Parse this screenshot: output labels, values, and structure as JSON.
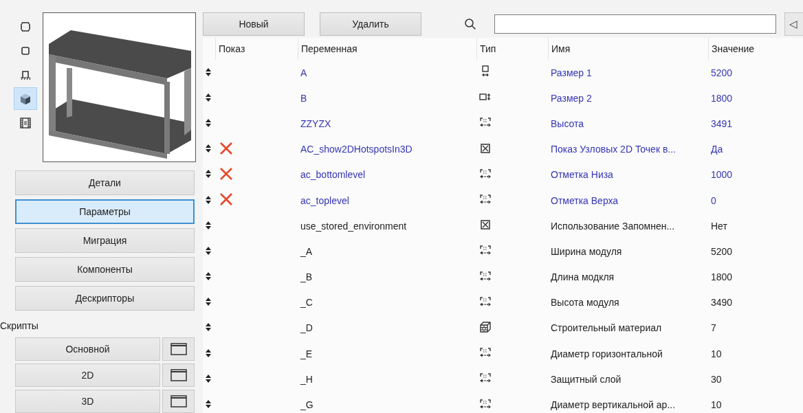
{
  "view_buttons": [
    {
      "kind": "frame",
      "selected": false
    },
    {
      "kind": "square",
      "selected": false
    },
    {
      "kind": "support",
      "selected": false
    },
    {
      "kind": "cube",
      "selected": true
    },
    {
      "kind": "film",
      "selected": false
    }
  ],
  "sections": [
    {
      "label": "Детали",
      "selected": false
    },
    {
      "label": "Параметры",
      "selected": true
    },
    {
      "label": "Миграция",
      "selected": false
    },
    {
      "label": "Компоненты",
      "selected": false
    },
    {
      "label": "Дескрипторы",
      "selected": false
    }
  ],
  "scripts": {
    "title": "Скрипты",
    "items": [
      {
        "label": "Основной"
      },
      {
        "label": "2D"
      },
      {
        "label": "3D"
      }
    ]
  },
  "toolbar": {
    "buttons": [
      "Новый",
      "Удалить"
    ],
    "collapse": "◁"
  },
  "table": {
    "columns": [
      "Показ",
      "Переменная",
      "Тип",
      "Имя",
      "Значение"
    ],
    "rows": [
      {
        "hidden": false,
        "variable": "A",
        "kind": "dim_a",
        "name": "Размер 1",
        "value": "5200",
        "highlighted": true
      },
      {
        "hidden": false,
        "variable": "B",
        "kind": "dim_b",
        "name": "Размер 2",
        "value": "1800",
        "highlighted": true
      },
      {
        "hidden": false,
        "variable": "ZZYZX",
        "kind": "length",
        "name": "Высота",
        "value": "3491",
        "highlighted": true
      },
      {
        "hidden": true,
        "variable": "AC_show2DHotspotsIn3D",
        "kind": "boolean",
        "name": "Показ Узловых 2D Точек в...",
        "value": "Да",
        "highlighted": true
      },
      {
        "hidden": true,
        "variable": "ac_bottomlevel",
        "kind": "length",
        "name": "Отметка Низа",
        "value": "1000",
        "highlighted": true
      },
      {
        "hidden": true,
        "variable": "ac_toplevel",
        "kind": "length",
        "name": "Отметка Верха",
        "value": "0",
        "highlighted": true
      },
      {
        "hidden": false,
        "variable": "use_stored_environment",
        "kind": "boolean",
        "name": "Использование Запомнен...",
        "value": "Нет",
        "highlighted": false
      },
      {
        "hidden": false,
        "variable": "_A",
        "kind": "length",
        "name": "Ширина модуля",
        "value": "5200",
        "highlighted": false
      },
      {
        "hidden": false,
        "variable": "_B",
        "kind": "length",
        "name": "Длина модкля",
        "value": "1800",
        "highlighted": false
      },
      {
        "hidden": false,
        "variable": "_C",
        "kind": "length",
        "name": "Высота модуля",
        "value": "3490",
        "highlighted": false
      },
      {
        "hidden": false,
        "variable": "_D",
        "kind": "material",
        "name": "Строительный материал",
        "value": "7",
        "highlighted": false
      },
      {
        "hidden": false,
        "variable": "_E",
        "kind": "length",
        "name": "Диаметр горизонтальной",
        "value": "10",
        "highlighted": false
      },
      {
        "hidden": false,
        "variable": "_H",
        "kind": "length",
        "name": "Защитный слой",
        "value": "30",
        "highlighted": false
      },
      {
        "hidden": false,
        "variable": "_G",
        "kind": "length",
        "name": "Диаметр вертикальной ар...",
        "value": "10",
        "highlighted": false
      }
    ]
  }
}
